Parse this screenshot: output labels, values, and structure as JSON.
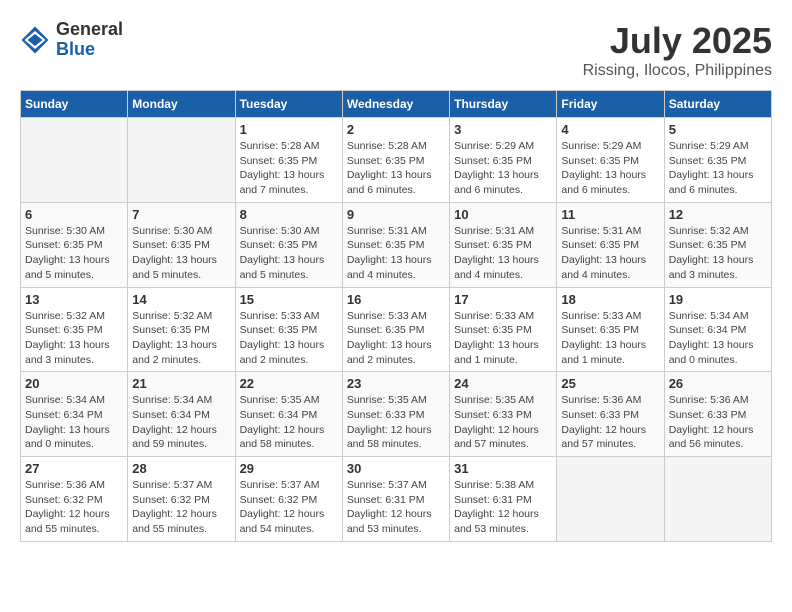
{
  "header": {
    "logo_general": "General",
    "logo_blue": "Blue",
    "month_year": "July 2025",
    "location": "Rissing, Ilocos, Philippines"
  },
  "weekdays": [
    "Sunday",
    "Monday",
    "Tuesday",
    "Wednesday",
    "Thursday",
    "Friday",
    "Saturday"
  ],
  "weeks": [
    [
      {
        "day": "",
        "detail": ""
      },
      {
        "day": "",
        "detail": ""
      },
      {
        "day": "1",
        "detail": "Sunrise: 5:28 AM\nSunset: 6:35 PM\nDaylight: 13 hours\nand 7 minutes."
      },
      {
        "day": "2",
        "detail": "Sunrise: 5:28 AM\nSunset: 6:35 PM\nDaylight: 13 hours\nand 6 minutes."
      },
      {
        "day": "3",
        "detail": "Sunrise: 5:29 AM\nSunset: 6:35 PM\nDaylight: 13 hours\nand 6 minutes."
      },
      {
        "day": "4",
        "detail": "Sunrise: 5:29 AM\nSunset: 6:35 PM\nDaylight: 13 hours\nand 6 minutes."
      },
      {
        "day": "5",
        "detail": "Sunrise: 5:29 AM\nSunset: 6:35 PM\nDaylight: 13 hours\nand 6 minutes."
      }
    ],
    [
      {
        "day": "6",
        "detail": "Sunrise: 5:30 AM\nSunset: 6:35 PM\nDaylight: 13 hours\nand 5 minutes."
      },
      {
        "day": "7",
        "detail": "Sunrise: 5:30 AM\nSunset: 6:35 PM\nDaylight: 13 hours\nand 5 minutes."
      },
      {
        "day": "8",
        "detail": "Sunrise: 5:30 AM\nSunset: 6:35 PM\nDaylight: 13 hours\nand 5 minutes."
      },
      {
        "day": "9",
        "detail": "Sunrise: 5:31 AM\nSunset: 6:35 PM\nDaylight: 13 hours\nand 4 minutes."
      },
      {
        "day": "10",
        "detail": "Sunrise: 5:31 AM\nSunset: 6:35 PM\nDaylight: 13 hours\nand 4 minutes."
      },
      {
        "day": "11",
        "detail": "Sunrise: 5:31 AM\nSunset: 6:35 PM\nDaylight: 13 hours\nand 4 minutes."
      },
      {
        "day": "12",
        "detail": "Sunrise: 5:32 AM\nSunset: 6:35 PM\nDaylight: 13 hours\nand 3 minutes."
      }
    ],
    [
      {
        "day": "13",
        "detail": "Sunrise: 5:32 AM\nSunset: 6:35 PM\nDaylight: 13 hours\nand 3 minutes."
      },
      {
        "day": "14",
        "detail": "Sunrise: 5:32 AM\nSunset: 6:35 PM\nDaylight: 13 hours\nand 2 minutes."
      },
      {
        "day": "15",
        "detail": "Sunrise: 5:33 AM\nSunset: 6:35 PM\nDaylight: 13 hours\nand 2 minutes."
      },
      {
        "day": "16",
        "detail": "Sunrise: 5:33 AM\nSunset: 6:35 PM\nDaylight: 13 hours\nand 2 minutes."
      },
      {
        "day": "17",
        "detail": "Sunrise: 5:33 AM\nSunset: 6:35 PM\nDaylight: 13 hours\nand 1 minute."
      },
      {
        "day": "18",
        "detail": "Sunrise: 5:33 AM\nSunset: 6:35 PM\nDaylight: 13 hours\nand 1 minute."
      },
      {
        "day": "19",
        "detail": "Sunrise: 5:34 AM\nSunset: 6:34 PM\nDaylight: 13 hours\nand 0 minutes."
      }
    ],
    [
      {
        "day": "20",
        "detail": "Sunrise: 5:34 AM\nSunset: 6:34 PM\nDaylight: 13 hours\nand 0 minutes."
      },
      {
        "day": "21",
        "detail": "Sunrise: 5:34 AM\nSunset: 6:34 PM\nDaylight: 12 hours\nand 59 minutes."
      },
      {
        "day": "22",
        "detail": "Sunrise: 5:35 AM\nSunset: 6:34 PM\nDaylight: 12 hours\nand 58 minutes."
      },
      {
        "day": "23",
        "detail": "Sunrise: 5:35 AM\nSunset: 6:33 PM\nDaylight: 12 hours\nand 58 minutes."
      },
      {
        "day": "24",
        "detail": "Sunrise: 5:35 AM\nSunset: 6:33 PM\nDaylight: 12 hours\nand 57 minutes."
      },
      {
        "day": "25",
        "detail": "Sunrise: 5:36 AM\nSunset: 6:33 PM\nDaylight: 12 hours\nand 57 minutes."
      },
      {
        "day": "26",
        "detail": "Sunrise: 5:36 AM\nSunset: 6:33 PM\nDaylight: 12 hours\nand 56 minutes."
      }
    ],
    [
      {
        "day": "27",
        "detail": "Sunrise: 5:36 AM\nSunset: 6:32 PM\nDaylight: 12 hours\nand 55 minutes."
      },
      {
        "day": "28",
        "detail": "Sunrise: 5:37 AM\nSunset: 6:32 PM\nDaylight: 12 hours\nand 55 minutes."
      },
      {
        "day": "29",
        "detail": "Sunrise: 5:37 AM\nSunset: 6:32 PM\nDaylight: 12 hours\nand 54 minutes."
      },
      {
        "day": "30",
        "detail": "Sunrise: 5:37 AM\nSunset: 6:31 PM\nDaylight: 12 hours\nand 53 minutes."
      },
      {
        "day": "31",
        "detail": "Sunrise: 5:38 AM\nSunset: 6:31 PM\nDaylight: 12 hours\nand 53 minutes."
      },
      {
        "day": "",
        "detail": ""
      },
      {
        "day": "",
        "detail": ""
      }
    ]
  ]
}
